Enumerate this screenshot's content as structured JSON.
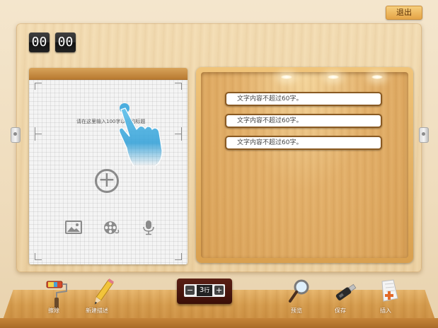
{
  "header": {
    "exit_label": "退出"
  },
  "timer": {
    "minutes": "00",
    "seconds": "00"
  },
  "notepad": {
    "hint": "请在这里输入100字以内的标题",
    "add_symbol": "+"
  },
  "shelf": {
    "items": [
      {
        "text": "文字内容不超过60字。"
      },
      {
        "text": "文字内容不超过60字。"
      },
      {
        "text": "文字内容不超过60字。"
      }
    ]
  },
  "toolbar": {
    "tools": [
      {
        "label": "擦除",
        "icon": "paint-roller-icon"
      },
      {
        "label": "新建描述",
        "icon": "pencil-icon"
      },
      {
        "label": "预览",
        "icon": "magnifier-icon"
      },
      {
        "label": "保存",
        "icon": "usb-drive-icon"
      },
      {
        "label": "插入",
        "icon": "insert-document-icon"
      }
    ],
    "stepper": {
      "minus": "−",
      "value": "3",
      "unit": "行",
      "plus": "+"
    }
  }
}
